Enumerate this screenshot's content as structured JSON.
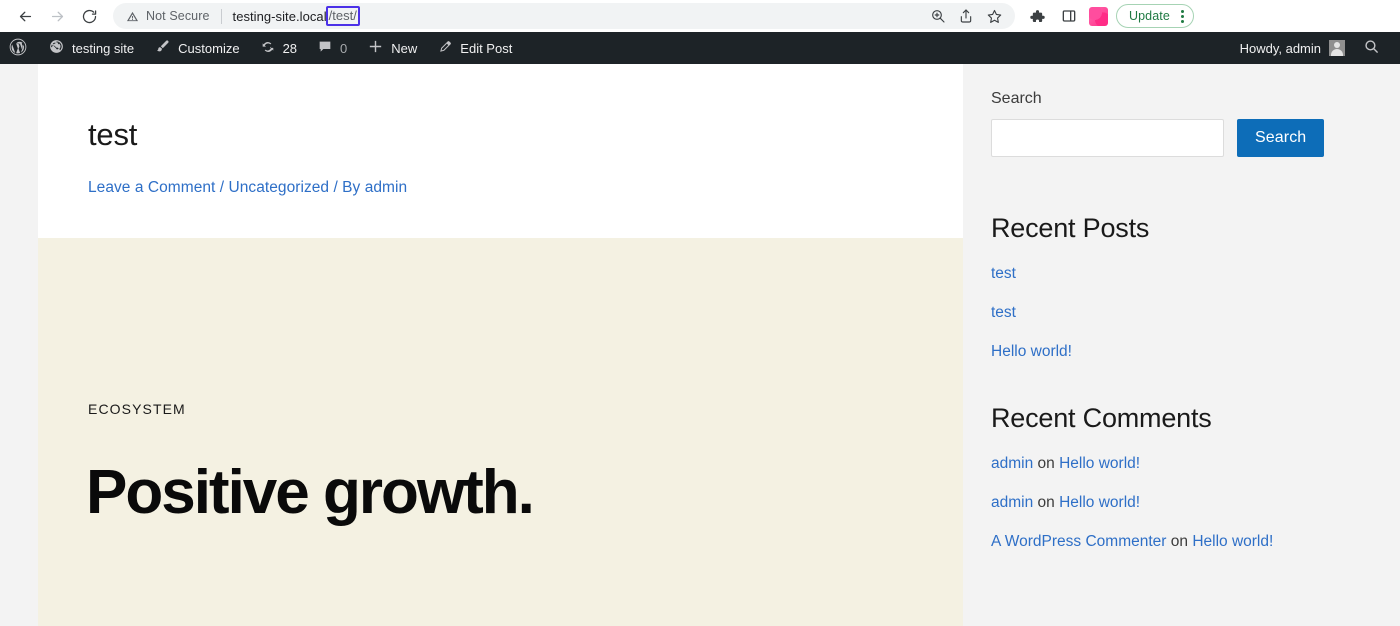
{
  "browser": {
    "back_icon": "back-arrow-icon",
    "forward_icon": "forward-arrow-icon",
    "reload_icon": "reload-icon",
    "security_label": "Not Secure",
    "url_host": "testing-site.local",
    "url_path": "/test/",
    "url_full": "testing-site.local/test/",
    "omnibox_icons": [
      "zoom-icon",
      "share-icon",
      "bookmark-star-icon"
    ],
    "toolbar_icons": [
      "extensions-puzzle-icon",
      "side-panel-icon",
      "profile-avatar-icon"
    ],
    "update_label": "Update",
    "update_accent": "#1f7a43",
    "kebab_icon": "kebab-menu-icon",
    "selection_outline": "#4c31e8"
  },
  "adminbar": {
    "background": "#1d2327",
    "logo_icon": "wordpress-logo-icon",
    "items": [
      {
        "icon": "dashboard-speedometer-icon",
        "label": "testing site"
      },
      {
        "icon": "paintbrush-icon",
        "label": "Customize"
      },
      {
        "icon": "update-arrows-icon",
        "label": "28"
      },
      {
        "icon": "comment-bubble-icon",
        "label": "0"
      },
      {
        "icon": "plus-icon",
        "label": "New"
      },
      {
        "icon": "pencil-icon",
        "label": "Edit Post"
      }
    ],
    "howdy": "Howdy, admin",
    "avatar_icon": "user-avatar-icon",
    "search_icon": "search-icon"
  },
  "article": {
    "title": "test",
    "meta": {
      "comment_link": "Leave a Comment",
      "sep1": "/",
      "category_link": "Uncategorized",
      "sep2": "/",
      "author": "By admin"
    }
  },
  "hero": {
    "background": "#f4f1e2",
    "eyebrow": "ECOSYSTEM",
    "heading": "Positive growth."
  },
  "sidebar": {
    "search": {
      "label": "Search",
      "value": "",
      "placeholder": "",
      "button_label": "Search",
      "button_color": "#0d6db8"
    },
    "recent_posts": {
      "title": "Recent Posts",
      "items": [
        "test",
        "test",
        "Hello world!"
      ]
    },
    "recent_comments": {
      "title": "Recent Comments",
      "on_word": "on",
      "items": [
        {
          "author": "admin",
          "post": "Hello world!"
        },
        {
          "author": "admin",
          "post": "Hello world!"
        },
        {
          "author": "A WordPress Commenter",
          "post": "Hello world!"
        }
      ]
    },
    "link_color": "#2e6fc7"
  }
}
